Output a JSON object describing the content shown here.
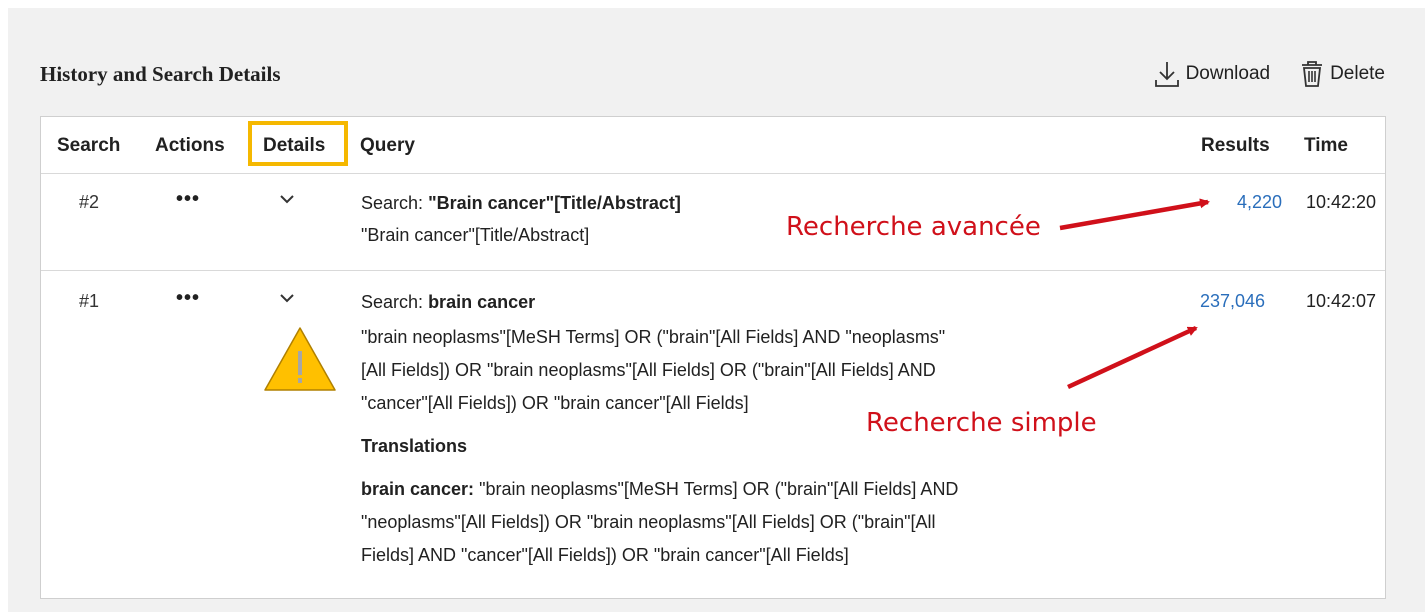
{
  "section": {
    "title": "History and Search Details",
    "download_label": "Download",
    "delete_label": "Delete"
  },
  "table": {
    "headers": [
      "Search",
      "Actions",
      "Details",
      "Query",
      "Results",
      "Time"
    ],
    "rows": [
      {
        "num": "#2",
        "actions": "•••",
        "search_prefix": "Search:",
        "search_term": "\"Brain cancer\"[Title/Abstract]",
        "details_lines": [
          "\"Brain cancer\"[Title/Abstract]"
        ],
        "results": "4,220",
        "time": "10:42:20"
      },
      {
        "num": "#1",
        "actions": "•••",
        "search_prefix": "Search:",
        "search_term": "brain cancer",
        "details_lines": [
          "\"brain neoplasms\"[MeSH Terms] OR (\"brain\"[All Fields] AND \"neoplasms\"",
          "[All Fields]) OR \"brain neoplasms\"[All Fields] OR (\"brain\"[All Fields] AND",
          "\"cancer\"[All Fields]) OR \"brain cancer\"[All Fields]"
        ],
        "translations_heading": "Translations",
        "translation_term": "brain cancer:",
        "translation_lines": [
          "\"brain neoplasms\"[MeSH Terms] OR (\"brain\"[All Fields] AND",
          "\"neoplasms\"[All Fields]) OR \"brain neoplasms\"[All Fields] OR (\"brain\"[All",
          "Fields] AND \"cancer\"[All Fields]) OR \"brain cancer\"[All Fields]"
        ],
        "results": "237,046",
        "time": "10:42:07"
      }
    ]
  },
  "annotations": {
    "advanced": "Recherche avancée",
    "simple": "Recherche simple",
    "color": "#d0101a"
  },
  "colors": {
    "highlight_box": "#f5b800",
    "warning_fill": "#ffc000",
    "link": "#2a6ebb"
  }
}
